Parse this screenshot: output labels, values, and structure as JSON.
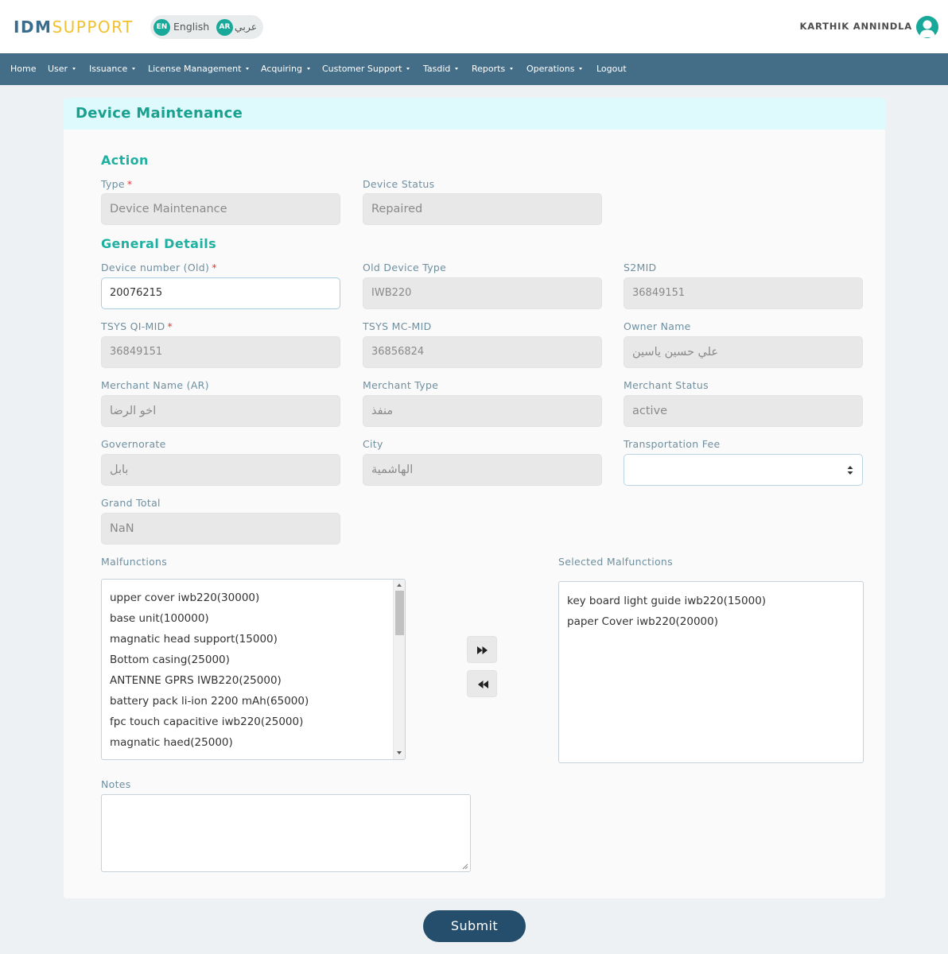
{
  "header": {
    "logo_part1": "IDM",
    "logo_part2": "SUPPORT",
    "lang_en_badge": "EN",
    "lang_en_label": "English",
    "lang_ar_badge": "AR",
    "lang_ar_label": "عربي",
    "user_name": "KARTHIK ANNINDLA",
    "avatar_icon": "user-avatar-icon"
  },
  "nav": {
    "items": [
      {
        "label": "Home",
        "dropdown": false
      },
      {
        "label": "User",
        "dropdown": true
      },
      {
        "label": "Issuance",
        "dropdown": true
      },
      {
        "label": "License Management",
        "dropdown": true
      },
      {
        "label": "Acquiring",
        "dropdown": true
      },
      {
        "label": "Customer Support",
        "dropdown": true
      },
      {
        "label": "Tasdid",
        "dropdown": true
      },
      {
        "label": "Reports",
        "dropdown": true
      },
      {
        "label": "Operations",
        "dropdown": true
      },
      {
        "label": "Logout",
        "dropdown": false
      }
    ]
  },
  "page": {
    "title": "Device Maintenance",
    "section_action": "Action",
    "section_general": "General Details",
    "required_mark": "*"
  },
  "fields": {
    "type": {
      "label": "Type",
      "value": "Device Maintenance"
    },
    "device_status": {
      "label": "Device Status",
      "value": "Repaired"
    },
    "device_number": {
      "label": "Device number (Old)",
      "value": "20076215"
    },
    "old_device_type": {
      "label": "Old Device Type",
      "value": "IWB220"
    },
    "s2mid": {
      "label": "S2MID",
      "value": "36849151"
    },
    "tsys_qi_mid": {
      "label": "TSYS QI-MID",
      "value": "36849151"
    },
    "tsys_mc_mid": {
      "label": "TSYS MC-MID",
      "value": "36856824"
    },
    "owner_name": {
      "label": "Owner Name",
      "value": "علي حسين ياسين"
    },
    "merchant_name_ar": {
      "label": "Merchant Name (AR)",
      "value": "اخو الرضا"
    },
    "merchant_type": {
      "label": "Merchant Type",
      "value": "منفذ"
    },
    "merchant_status": {
      "label": "Merchant Status",
      "value": "active"
    },
    "governorate": {
      "label": "Governorate",
      "value": "بابل"
    },
    "city": {
      "label": "City",
      "value": "الهاشمية"
    },
    "transportation_fee": {
      "label": "Transportation Fee",
      "value": ""
    },
    "grand_total": {
      "label": "Grand Total",
      "value": "NaN"
    }
  },
  "malfunctions": {
    "label": "Malfunctions",
    "items": [
      "upper cover iwb220(30000)",
      "base unit(100000)",
      "magnatic head support(15000)",
      "Bottom casing(25000)",
      "ANTENNE GPRS IWB220(25000)",
      "battery pack li-ion 2200 mAh(65000)",
      "fpc touch capacitive iwb220(25000)",
      "magnatic haed(25000)"
    ]
  },
  "selected_malfunctions": {
    "label": "Selected Malfunctions",
    "items": [
      "key board light guide iwb220(15000)",
      "paper Cover iwb220(20000)"
    ]
  },
  "buttons": {
    "move_right_icon": "fast-forward-icon",
    "move_left_icon": "rewind-icon",
    "submit": "Submit"
  },
  "notes": {
    "label": "Notes",
    "value": ""
  },
  "colors": {
    "nav_bg": "#446e88",
    "accent": "#19a08f",
    "submit_bg": "#244e6c",
    "logo_blue": "#3a6c8c",
    "logo_yellow": "#f2c12e"
  }
}
